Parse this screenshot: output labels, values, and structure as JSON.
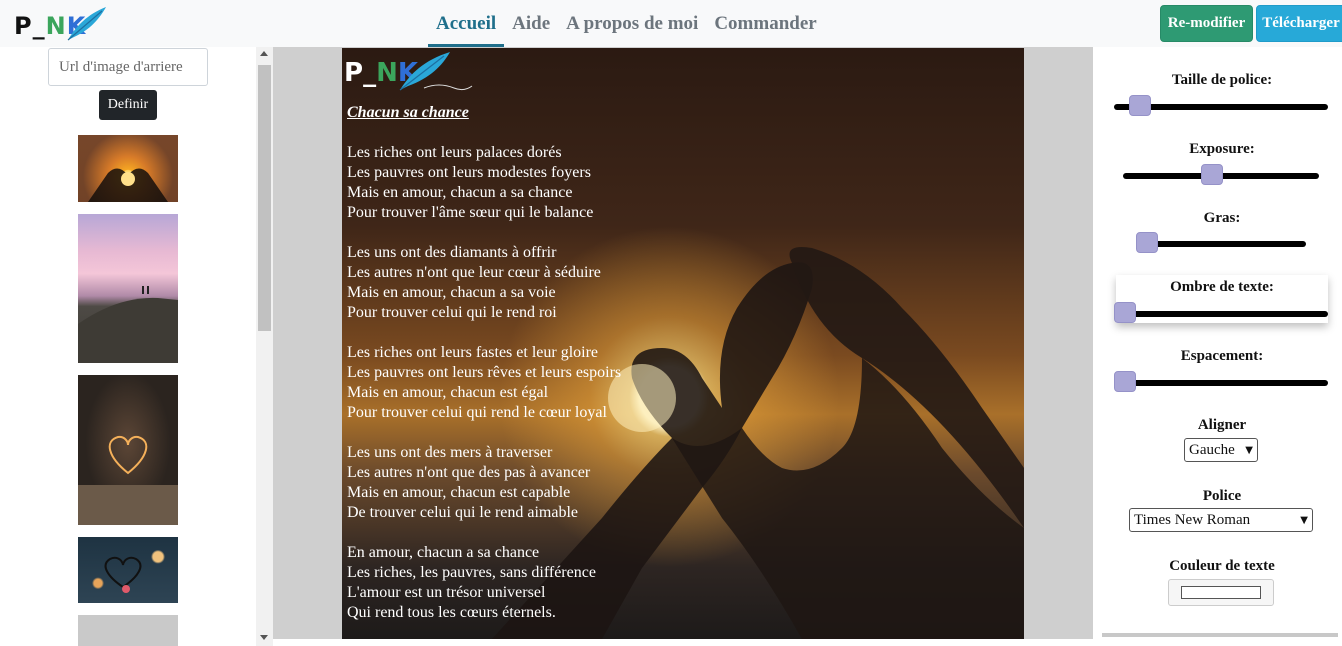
{
  "brand": {
    "logo_letters": [
      "P",
      "_",
      "N",
      "K"
    ]
  },
  "nav": {
    "items": [
      {
        "label": "Accueil",
        "active": true
      },
      {
        "label": "Aide",
        "active": false
      },
      {
        "label": "A propos de moi",
        "active": false
      },
      {
        "label": "Commander",
        "active": false
      }
    ]
  },
  "actions": {
    "remodify_label": "Re-modifier",
    "download_label": "Télécharger",
    "remodify_color": "#2e9a73",
    "download_color": "#27a9d8"
  },
  "left_panel": {
    "url_placeholder": "Url d'image d'arriere",
    "define_label": "Definir"
  },
  "poster": {
    "logo_letters": [
      "P",
      "_",
      "N",
      "K"
    ],
    "title": "Chacun sa chance",
    "stanzas": [
      [
        "Les riches ont leurs palaces dorés",
        "Les pauvres ont leurs modestes foyers",
        "Mais en amour, chacun a sa chance",
        "Pour trouver l'âme sœur qui le balance"
      ],
      [
        "Les uns ont des diamants à offrir",
        "Les autres n'ont que leur cœur à séduire",
        "Mais en amour, chacun a sa voie",
        "Pour trouver celui qui le rend roi"
      ],
      [
        "Les riches ont leurs fastes et leur gloire",
        "Les pauvres ont leurs rêves et leurs espoirs",
        "Mais en amour, chacun est égal",
        "Pour trouver celui qui rend le cœur loyal"
      ],
      [
        "Les uns ont des mers à traverser",
        "Les autres n'ont que des pas à avancer",
        "Mais en amour, chacun est capable",
        "De trouver celui qui le rend aimable"
      ],
      [
        "En amour, chacun a sa chance",
        "Les riches, les pauvres, sans différence",
        "L'amour est un trésor universel",
        "Qui rend tous les cœurs éternels."
      ]
    ]
  },
  "controls": {
    "font_size_label": "Taille de police:",
    "font_size_value": 0.08,
    "exposure_label": "Exposure:",
    "exposure_value": 0.45,
    "bold_label": "Gras:",
    "bold_value": 0.0,
    "shadow_label": "Ombre de texte:",
    "shadow_value": 0.0,
    "spacing_label": "Espacement:",
    "spacing_value": 0.0,
    "align_label": "Aligner",
    "align_value": "Gauche",
    "font_label": "Police",
    "font_value": "Times New Roman",
    "color_label": "Couleur de texte",
    "text_color": "#ffffff",
    "knob_color": "#a9a6d6"
  }
}
